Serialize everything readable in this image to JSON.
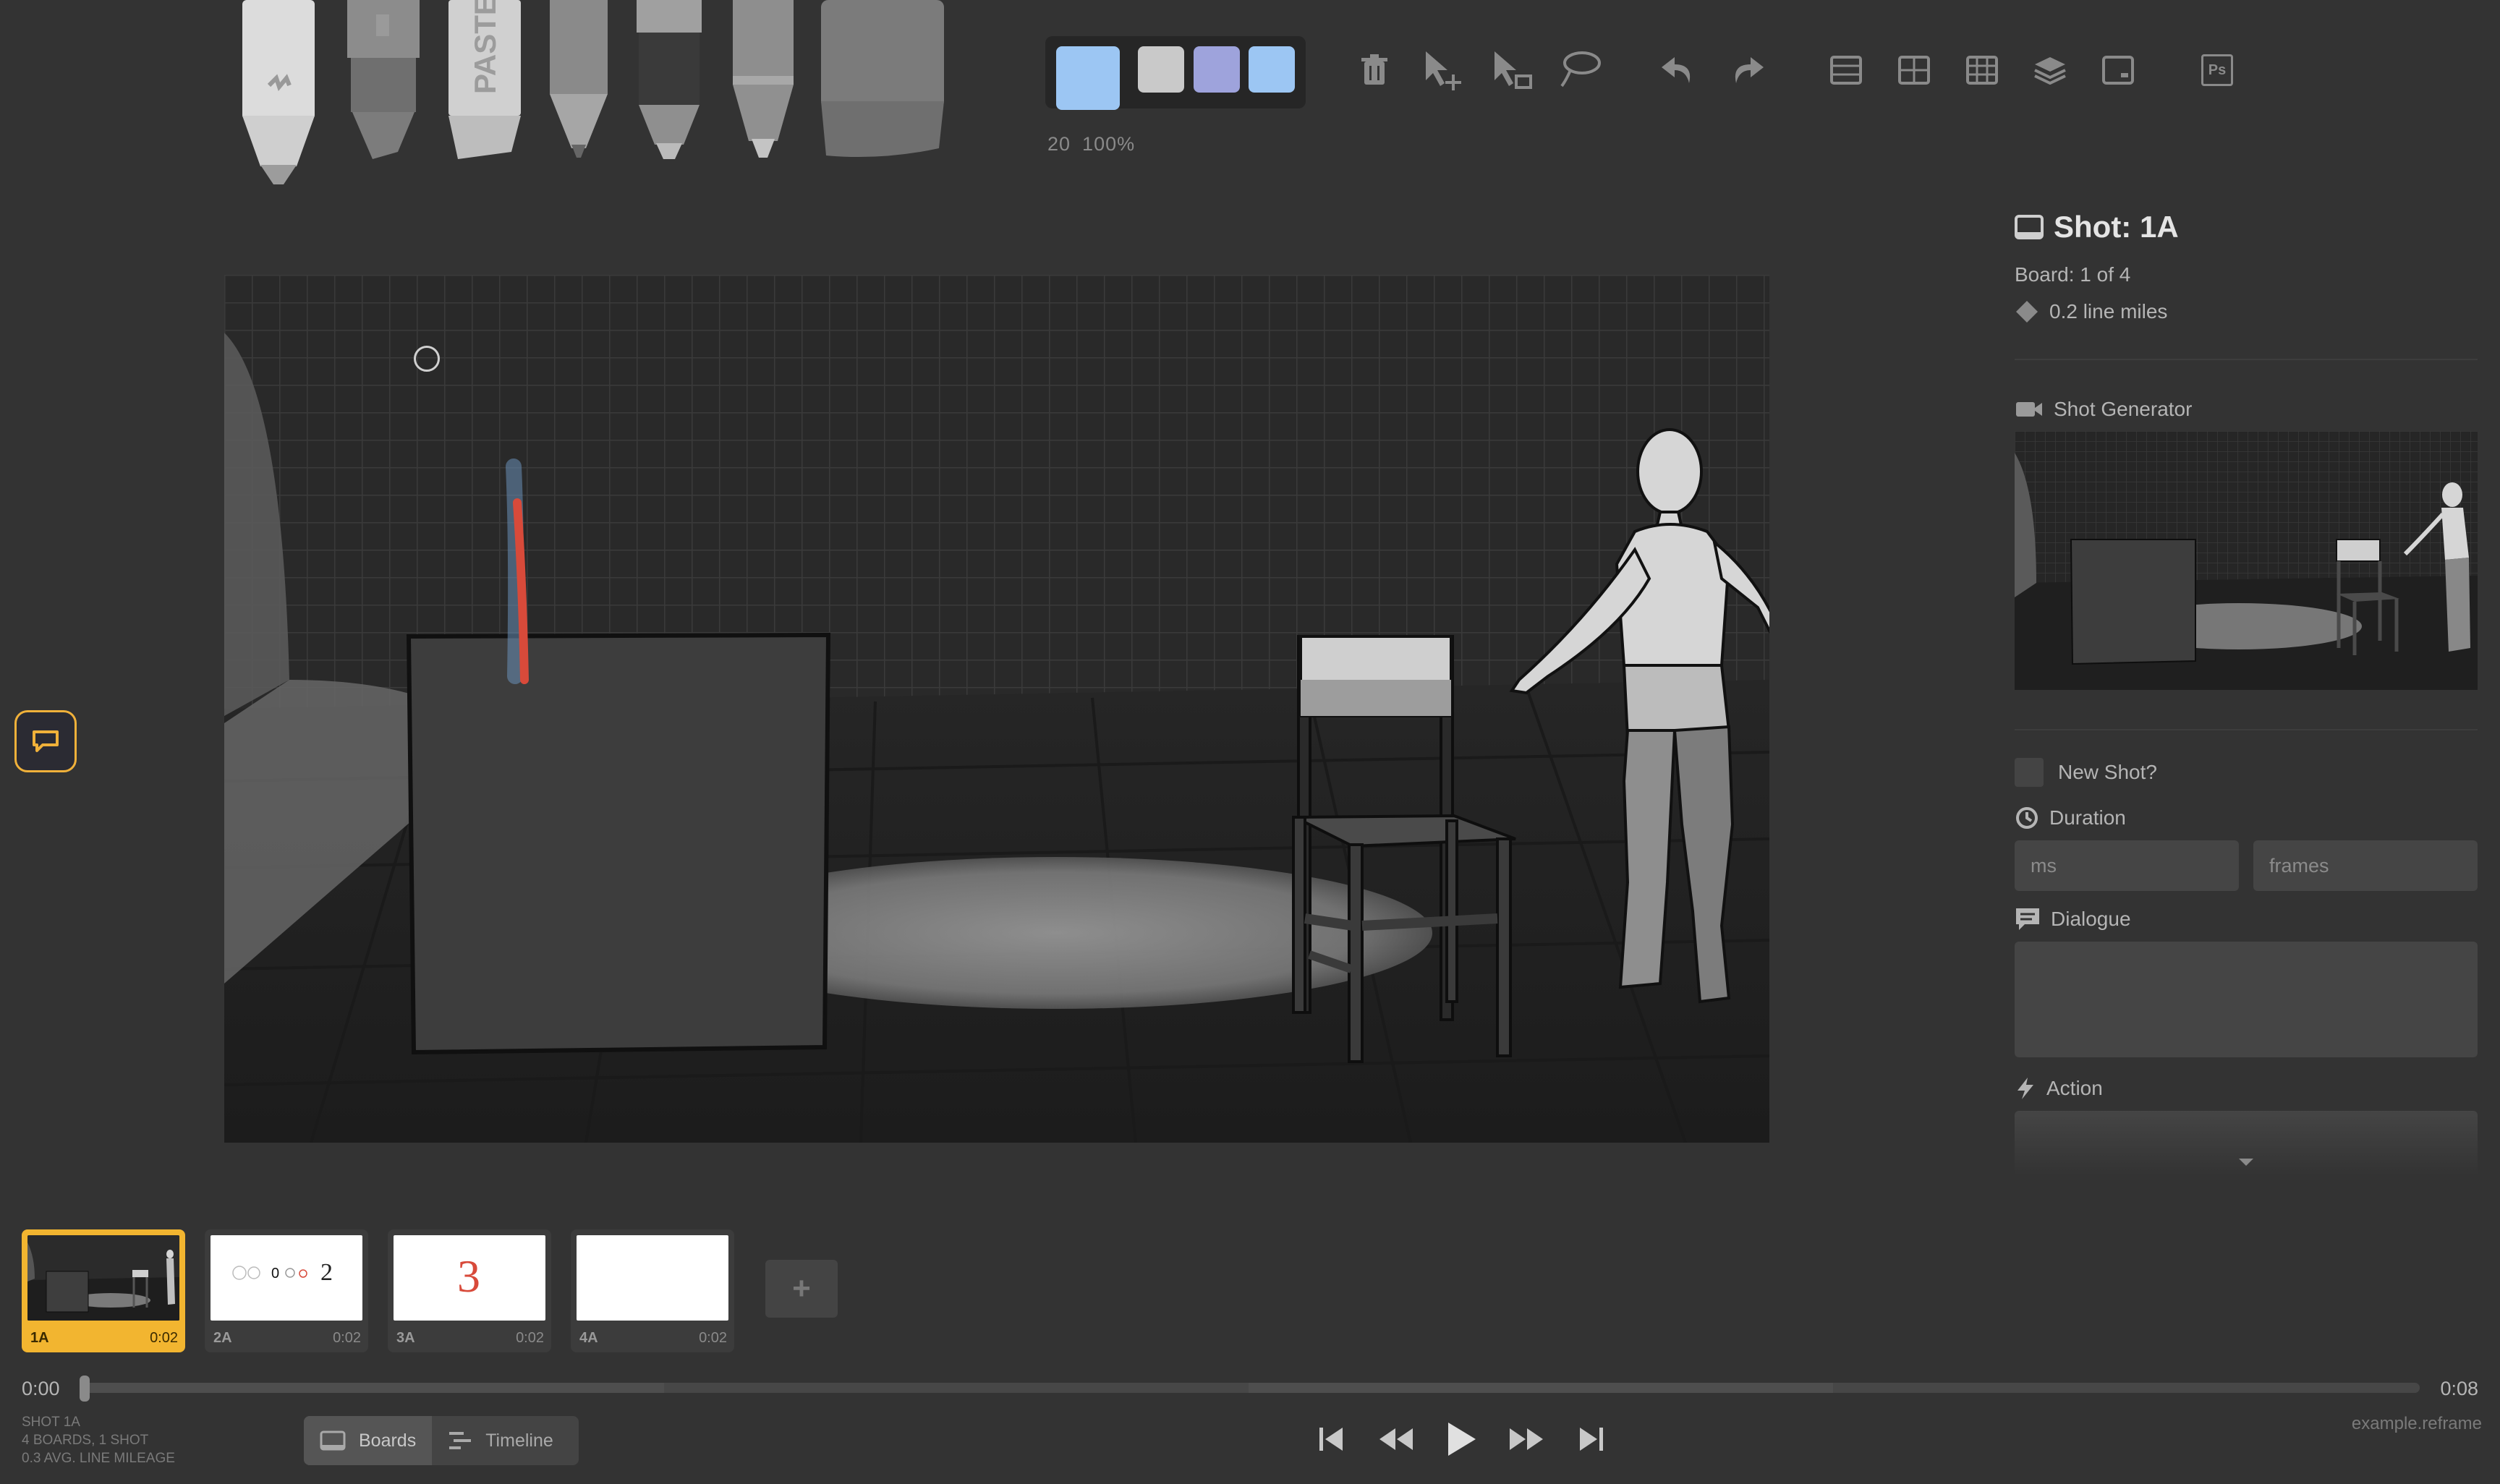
{
  "toolbar": {
    "brush_size": "20",
    "brush_opacity": "100%",
    "tools": [
      "light-pencil-tool",
      "brush-tool",
      "pastel-tool",
      "pencil-tool",
      "marker-tool",
      "pen-tool",
      "eraser-tool"
    ],
    "pastel_text": "PASTEL",
    "palette": {
      "current": "#9cc6f3",
      "swatches": [
        "#c9c9c9",
        "#9ea3dc",
        "#9cc6f3"
      ]
    },
    "actions": [
      "trash-icon",
      "move-icon",
      "scale-icon",
      "lasso-icon",
      "undo-icon",
      "redo-icon",
      "grid-1-icon",
      "grid-2-icon",
      "grid-3-icon",
      "layers-icon",
      "caption-icon",
      "photoshop-icon"
    ],
    "ps_label": "Ps"
  },
  "panel": {
    "shot_title": "Shot: 1A",
    "board_count": "Board: 1 of 4",
    "line_miles": "0.2 line miles",
    "shot_generator_label": "Shot Generator",
    "new_shot_label": "New Shot?",
    "duration_label": "Duration",
    "ms_placeholder": "ms",
    "frames_placeholder": "frames",
    "dialogue_label": "Dialogue",
    "action_label": "Action"
  },
  "boards": [
    {
      "label": "1A",
      "duration": "0:02",
      "active": true
    },
    {
      "label": "2A",
      "duration": "0:02",
      "active": false
    },
    {
      "label": "3A",
      "duration": "0:02",
      "active": false
    },
    {
      "label": "4A",
      "duration": "0:02",
      "active": false
    }
  ],
  "board_sketches": {
    "board2": "0",
    "board2_number": "2",
    "board3_number": "3"
  },
  "add_board_symbol": "+",
  "timeline": {
    "start": "0:00",
    "end": "0:08",
    "playhead_fraction": 0.0
  },
  "stats": {
    "line1": "SHOT 1A",
    "line2": "4 BOARDS, 1 SHOT",
    "line3": "0.3 AVG. LINE MILEAGE"
  },
  "view_toggle": {
    "boards_label": "Boards",
    "timeline_label": "Timeline"
  },
  "filename": "example.reframe"
}
